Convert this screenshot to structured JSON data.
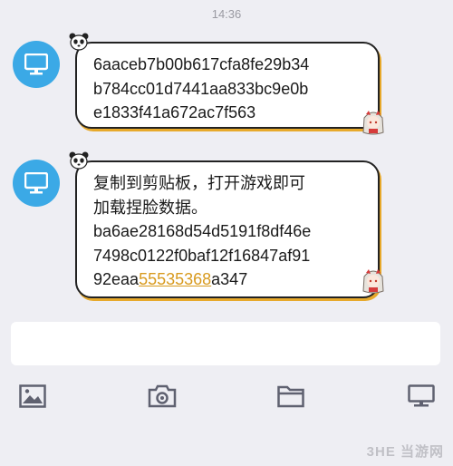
{
  "status_bar": {
    "time": "14:36"
  },
  "messages": [
    {
      "lines": [
        "6aaceb7b00b617cfa8fe29b34",
        "b784cc01d7441aa833bc9e0b",
        "e1833f41a672ac7f563"
      ]
    },
    {
      "lines": [
        "复制到剪贴板，打开游戏即可",
        "加载捏脸数据。",
        "ba6ae28168d54d5191f8df46e",
        "7498c0122f0baf12f16847af91"
      ],
      "last_prefix": "92eaa",
      "last_link": "55535368",
      "last_suffix": "a347"
    }
  ],
  "input": {
    "placeholder": ""
  },
  "toolbar": {
    "icons": [
      "image-icon",
      "camera-icon",
      "folder-icon",
      "monitor-icon"
    ]
  },
  "watermark": "3HE 当游网",
  "colors": {
    "avatar": "#3ba9e6",
    "link": "#d89a1e",
    "bubble_shadow": "#e7a92b",
    "icon": "#5f6170"
  }
}
